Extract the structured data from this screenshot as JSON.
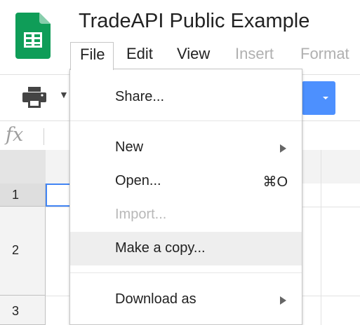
{
  "document": {
    "title": "TradeAPI Public Example"
  },
  "app_icon": {
    "icon": "google-sheets-icon",
    "color": "#0F9D58"
  },
  "menubar": {
    "items": [
      {
        "label": "File",
        "active": true
      },
      {
        "label": "Edit"
      },
      {
        "label": "View"
      },
      {
        "label": "Insert",
        "disabled": true
      },
      {
        "label": "Format",
        "disabled": true
      }
    ]
  },
  "toolbar": {
    "print_icon": "printer-icon",
    "accent": "#4D90FE"
  },
  "formula_bar": {
    "fx_label": "fx"
  },
  "grid": {
    "rows": [
      {
        "label": "1",
        "selected": true
      },
      {
        "label": "2"
      },
      {
        "label": "3"
      }
    ],
    "selection_color": "#4285F4"
  },
  "file_menu": {
    "items": [
      {
        "label": "Share..."
      },
      {
        "label": "New",
        "submenu": true
      },
      {
        "label": "Open...",
        "shortcut": "⌘O"
      },
      {
        "label": "Import...",
        "disabled": true
      },
      {
        "label": "Make a copy...",
        "highlighted": true
      },
      {
        "label": "Download as",
        "submenu": true
      }
    ]
  }
}
